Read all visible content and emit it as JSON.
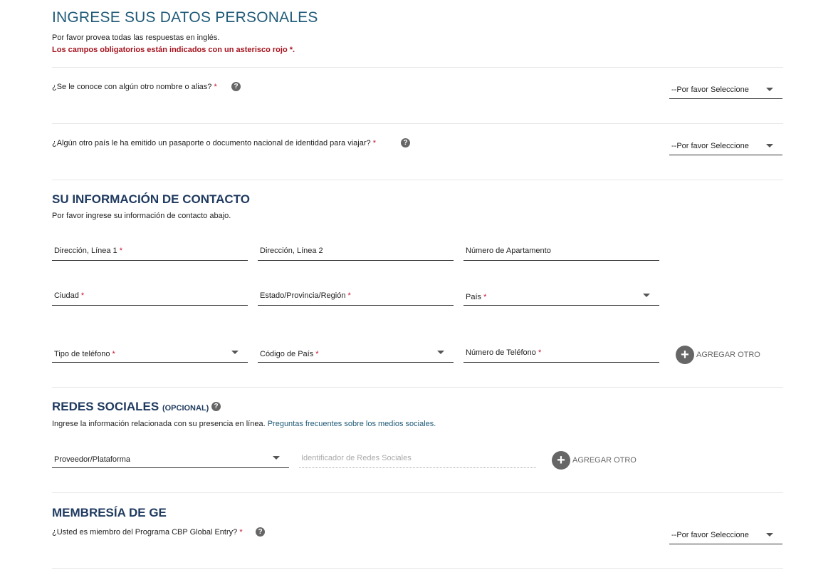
{
  "personal": {
    "title": "INGRESE SUS DATOS PERSONALES",
    "intro": "Por favor provea todas las respuestas en inglés.",
    "required_note": "Los campos obligatorios están indicados con un asterisco rojo *.",
    "q_alias": "¿Se le conoce con algún otro nombre o alias?",
    "q_passport": "¿Algún otro país le ha emitido un pasaporte o documento nacional de identidad para viajar?",
    "select_placeholder": "--Por favor Seleccione"
  },
  "contact": {
    "title": "SU INFORMACIÓN DE CONTACTO",
    "intro": "Por favor ingrese su información de contacto abajo.",
    "address1": "Dirección, Línea 1",
    "address2": "Dirección, Línea 2",
    "apartment": "Número de Apartamento",
    "city": "Ciudad",
    "state": "Estado/Provincia/Región",
    "country": "País",
    "phone_type": "Tipo de teléfono",
    "country_code": "Código de País",
    "phone_number": "Número de Teléfono",
    "add_other": "AGREGAR OTRO"
  },
  "social": {
    "title": "REDES SOCIALES",
    "optional": "(OPCIONAL)",
    "intro": "Ingrese la información relacionada con su presencia en línea.",
    "faq_link": "Preguntas frecuentes sobre los medios sociales.",
    "provider": "Proveedor/Plataforma",
    "identifier_placeholder": "Identificador de Redes Sociales",
    "add_other": "AGREGAR OTRO"
  },
  "ge": {
    "title": "MEMBRESÍA DE GE",
    "question": "¿Usted es miembro del Programa CBP Global Entry?",
    "select_placeholder": "--Por favor Seleccione"
  },
  "required_mark": "*",
  "help_glyph": "?",
  "plus_glyph": "+"
}
